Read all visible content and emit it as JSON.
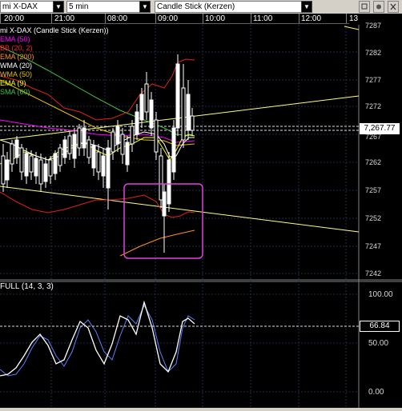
{
  "toolbar": {
    "symbol": "mi X-DAX",
    "interval": "5 min",
    "chart_type": "Candle Stick (Kerzen)"
  },
  "time_axis": {
    "labels": [
      "20:00",
      "21:00",
      "08:00",
      "09:00",
      "10:00",
      "11:00",
      "12:00",
      "13"
    ]
  },
  "indicators": [
    {
      "label": "mi X-DAX (Candle Stick (Kerzen))",
      "color": "#ffffff"
    },
    {
      "label": "EMA (50)",
      "color": "#ff00ff"
    },
    {
      "label": "BB (20, 2)",
      "color": "#ff2020"
    },
    {
      "label": "EMA (200)",
      "color": "#ff9020"
    },
    {
      "label": "WMA (20)",
      "color": "#ffffff"
    },
    {
      "label": "WMA (50)",
      "color": "#e0c000"
    },
    {
      "label": "EMA (9)",
      "color": "#ffff00"
    },
    {
      "label": "SMA (60)",
      "color": "#40c040"
    }
  ],
  "price_axis": {
    "labels": [
      "7287",
      "7282",
      "7277",
      "7272",
      "7267",
      "7262",
      "7257",
      "7252",
      "7247",
      "7242"
    ],
    "last_price": "7,267.77"
  },
  "stochastic": {
    "label": "FULL (14, 3, 3)",
    "axis_labels": [
      "100.00",
      "50.00",
      "0.00"
    ],
    "current_value": "66.84"
  },
  "colors": {
    "background": "#000000",
    "grid": "#2a3a5a",
    "up_candle": "#ffffff",
    "down_candle": "#000000",
    "highlight_box": "#e040e0",
    "trendline": "#ffff80",
    "stochastic_k": "#ffffff",
    "stochastic_d": "#6080ff"
  }
}
